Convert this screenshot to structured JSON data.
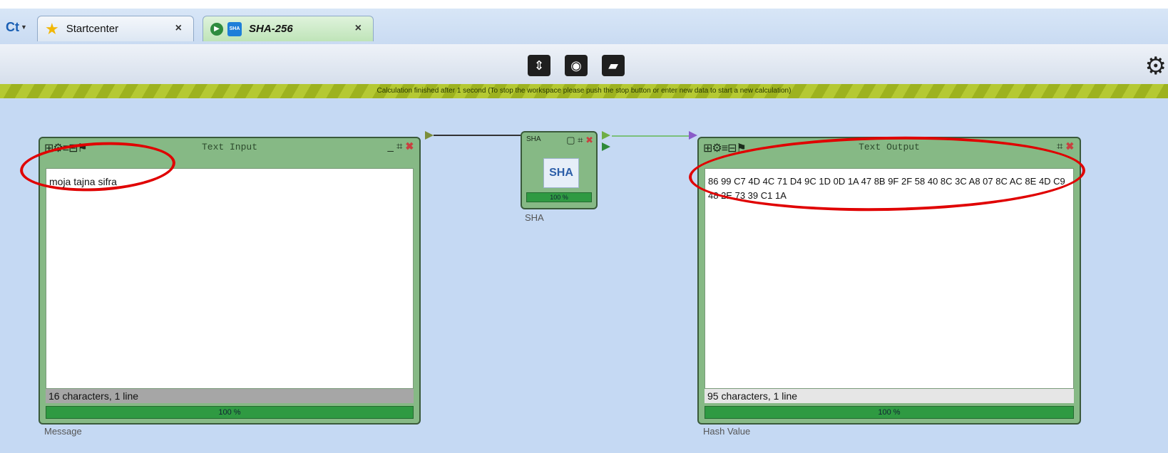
{
  "tabs": [
    {
      "label": "Startcenter",
      "close": "×"
    },
    {
      "label": "SHA-256",
      "close": "×",
      "icon_text": "SHA"
    }
  ],
  "toolbar": {
    "buttons": [
      "maximize-icon",
      "screenshot-camera-icon",
      "comment-icon"
    ],
    "settings_icon": "gear-icon"
  },
  "status": {
    "message": "Calculation finished after 1 second (To stop the workspace please push the stop button or enter new data to start a new calculation)"
  },
  "components": {
    "text_input": {
      "title": "Text Input",
      "content": "moja tajna sifra",
      "stats": "16 characters,  1 line",
      "progress": "100 %",
      "caption": "Message"
    },
    "sha": {
      "header_label": "SHA",
      "logo_text": "SHA",
      "progress": "100 %",
      "caption": "SHA"
    },
    "text_output": {
      "title": "Text Output",
      "content": "86 99 C7 4D 4C 71 D4 9C 1D 0D 1A 47 8B 9F 2F 58 40 8C 3C A8 07 8C AC 8E 4D C9 48 2E 73 39 C1 1A",
      "stats": "95 characters,  1 line",
      "progress": "100 %",
      "caption": "Hash Value"
    }
  },
  "colors": {
    "component_green": "#86b985",
    "progress_green": "#2f9a42",
    "highlight_red": "#e00000",
    "workspace_blue": "#c5d9f3"
  }
}
